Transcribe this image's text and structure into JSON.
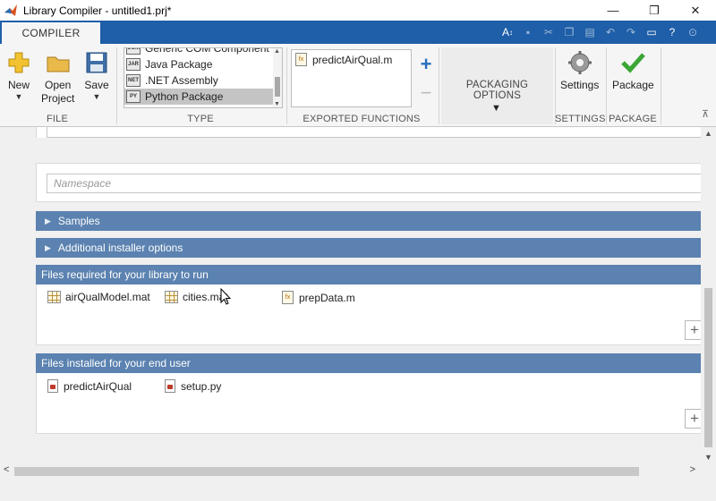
{
  "window": {
    "title": "Library Compiler - untitled1.prj*",
    "minimize_glyph": "—",
    "maximize_glyph": "❐",
    "close_glyph": "✕"
  },
  "tabs": {
    "compiler": "COMPILER"
  },
  "quick_access": [
    "font-size-icon",
    "save-icon",
    "cut-icon",
    "copy-icon",
    "paste-icon",
    "undo-icon",
    "redo-icon",
    "window-icon",
    "help-icon",
    "dropdown-icon"
  ],
  "ribbon": {
    "new_label": "New",
    "open_label_line1": "Open",
    "open_label_line2": "Project",
    "save_label": "Save",
    "file_section": "FILE",
    "type_section": "TYPE",
    "type_items": [
      {
        "label": "Generic COM Component",
        "icon": "COM"
      },
      {
        "label": "Java Package",
        "icon": "JAR"
      },
      {
        "label": ".NET Assembly",
        "icon": "NET"
      },
      {
        "label": "Python Package",
        "icon": "PY"
      }
    ],
    "exported_functions": [
      "predictAirQual.m"
    ],
    "exported_section": "EXPORTED FUNCTIONS",
    "packaging_options_label": "PACKAGING OPTIONS",
    "settings_label": "Settings",
    "settings_section": "SETTINGS",
    "package_label": "Package",
    "package_section": "PACKAGE"
  },
  "form": {
    "namespace_placeholder": "Namespace",
    "samples_label": "Samples",
    "installer_options_label": "Additional installer options",
    "required_files_title": "Files required for your library to run",
    "required_files": [
      {
        "name": "airQualModel.mat",
        "type": "mat"
      },
      {
        "name": "cities.mat",
        "type": "mat"
      },
      {
        "name": "prepData.m",
        "type": "m"
      }
    ],
    "installed_files_title": "Files installed for your end user",
    "installed_files": [
      {
        "name": "predictAirQual",
        "type": "doc"
      },
      {
        "name": "setup.py",
        "type": "doc"
      }
    ],
    "add_glyph": "+"
  },
  "colors": {
    "tab_strip": "#1f5ea8",
    "section_bar": "#5b82b0",
    "package_check": "#3aa635",
    "new_star": "#f2c230"
  }
}
